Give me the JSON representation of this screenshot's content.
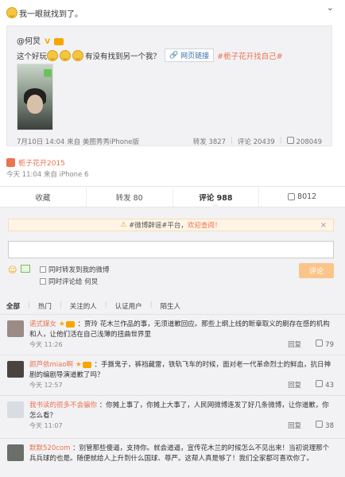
{
  "post": {
    "text": "我一眼就找到了。",
    "expand_icon": "chevron-down-icon"
  },
  "repost": {
    "author": "@何炅",
    "text_prefix": "这个好玩",
    "text_mid": "有没有找到另一个我？",
    "link_label": "网页链接",
    "topic": "#栀子花开找自己#",
    "meta": "7月10日 14:04 来自 美图秀秀iPhone版",
    "forward": "转发 3827",
    "comments": "评论 20439",
    "likes": "208049"
  },
  "source": {
    "label": "栀子花开2015"
  },
  "post_meta": "今天 11:04 来自 iPhone 6",
  "actions": {
    "collect": "收藏",
    "forward": "转发 80",
    "comment": "评论 988",
    "like": "8012"
  },
  "notice": {
    "prefix": "#微博辟谣#平台，",
    "highlight": "欢迎查阅！"
  },
  "options": {
    "forward_to_weibo": "同时转发到我的微博",
    "comment_to": "同时评论给 何炅",
    "submit": "评论"
  },
  "filters": [
    "全部",
    "热门",
    "关注的人",
    "认证用户",
    "陌生人"
  ],
  "comments": [
    {
      "name": "诺式媒女",
      "text": "：贾玲 花木兰作品的事，无须道歉回应。那些上纲上线的断章取义的刷存在感的机构和人，让他们活在自己浅薄的扭曲世界里",
      "time": "今天 11:26",
      "reply": "回复",
      "likes": "79",
      "avatar": "#9b8a86"
    },
    {
      "name": "颜芦依miao啊",
      "text": "：手撕鬼子，裤裆藏雷，铁轨飞车的时候，面对老一代革命烈士的鲜血，抗日神剧的编剧导演道歉了吗？",
      "time": "今天 12:57",
      "reply": "回复",
      "likes": "43",
      "avatar": "#4a4441"
    },
    {
      "name": "我书读的很多不会骗你",
      "text": "：你摊上事了，你摊上大事了，人民网微博连发了好几条微博，让你道歉，你怎么看？",
      "time": "今天 11:07",
      "reply": "回复",
      "likes": "38",
      "avatar": "#d8dce3"
    },
    {
      "name": "默默520com",
      "text": "：别管那些傻逼，支持你。就会道逼，宣传花木兰的时候怎么不见出来！当初说理那个兵兵球的也是。随便就给人上升到什么国球、尊严。这帮人真是够了！我们全家都可喜欢你了。",
      "time": "",
      "reply": "",
      "likes": "",
      "avatar": "#6b6f6a"
    }
  ],
  "colors": {
    "accent": "#eb7350",
    "submit": "#fbc58a",
    "gold": "#f7a600"
  }
}
